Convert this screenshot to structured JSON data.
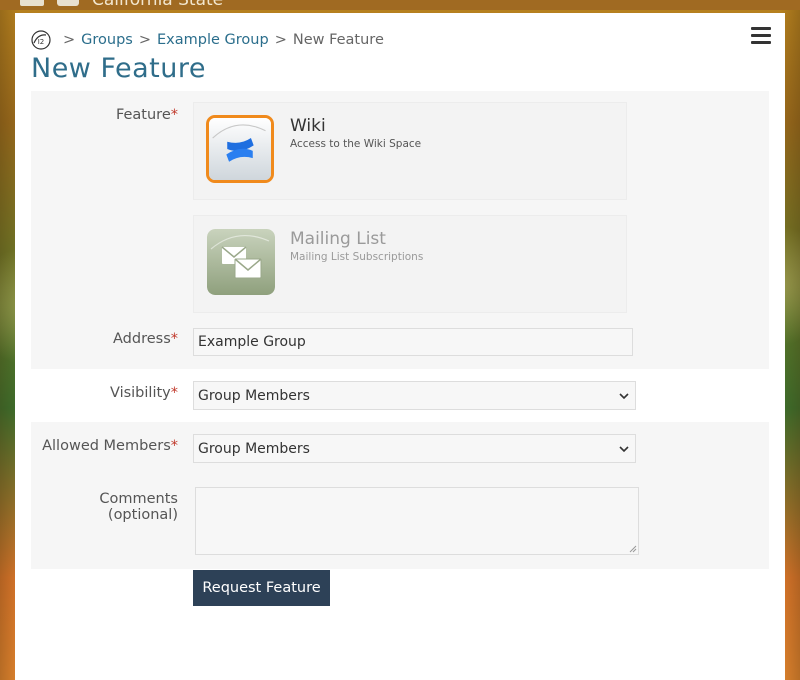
{
  "header": {
    "site_title": "California State"
  },
  "breadcrumb": {
    "home_icon": "home-logo-icon",
    "separator": ">",
    "items": [
      {
        "label": "Groups"
      },
      {
        "label": "Example Group"
      }
    ],
    "current": "New Feature"
  },
  "page": {
    "title": "New Feature",
    "menu_icon": "hamburger-menu-icon"
  },
  "form": {
    "required_mark": "*",
    "feature": {
      "label": "Feature",
      "options": [
        {
          "name": "Wiki",
          "description": "Access to the Wiki Space",
          "icon": "wiki-icon",
          "selected": true
        },
        {
          "name": "Mailing List",
          "description": "Mailing List Subscriptions",
          "icon": "mailing-list-icon",
          "selected": false
        }
      ]
    },
    "address": {
      "label": "Address",
      "value": "Example Group"
    },
    "visibility": {
      "label": "Visibility",
      "value": "Group Members"
    },
    "allowed_members": {
      "label": "Allowed Members",
      "value": "Group Members"
    },
    "comments": {
      "label": "Comments (optional)",
      "value": ""
    },
    "submit_label": "Request Feature"
  },
  "colors": {
    "accent": "#2f6d8a",
    "link": "#2b6e8c",
    "required": "#c0392b",
    "button": "#2d4157",
    "selected_border": "#f08a1c"
  }
}
